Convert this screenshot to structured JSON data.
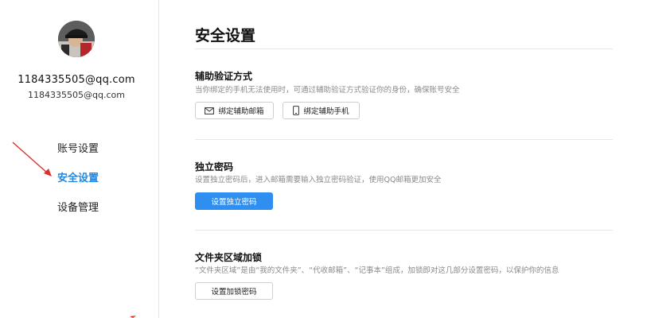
{
  "profile": {
    "display_name": "1184335505@qq.com",
    "email": "1184335505@qq.com"
  },
  "sidebar": {
    "items": [
      {
        "label": "账号设置",
        "active": false
      },
      {
        "label": "安全设置",
        "active": true
      },
      {
        "label": "设备管理",
        "active": false
      }
    ]
  },
  "main": {
    "title": "安全设置",
    "sections": [
      {
        "title": "辅助验证方式",
        "description": "当你绑定的手机无法使用时，可通过辅助验证方式验证你的身份，确保账号安全",
        "buttons": [
          {
            "label": "绑定辅助邮箱",
            "icon": "mail-icon"
          },
          {
            "label": "绑定辅助手机",
            "icon": "phone-icon"
          }
        ]
      },
      {
        "title": "独立密码",
        "description": "设置独立密码后，进入邮箱需要输入独立密码验证，使用QQ邮箱更加安全",
        "buttons": [
          {
            "label": "设置独立密码",
            "primary": true
          }
        ]
      },
      {
        "title": "文件夹区域加锁",
        "description": "“文件夹区域”是由“我的文件夹”、“代收邮箱”、“记事本”组成，加锁即对这几部分设置密码，以保护你的信息",
        "buttons": [
          {
            "label": "设置加锁密码"
          }
        ]
      }
    ]
  },
  "colors": {
    "accent": "#2f8ff0",
    "active_nav": "#1e88e5",
    "annotation_arrow": "#d9322b",
    "divider": "#e8e8e8",
    "muted_text": "#8a8a8a"
  }
}
